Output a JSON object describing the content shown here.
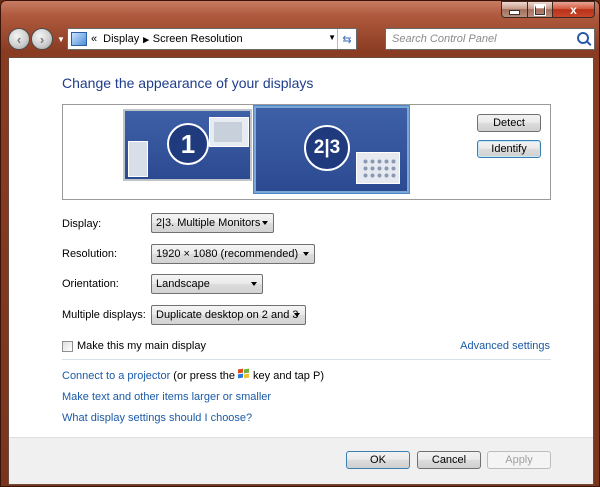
{
  "window": {
    "caption": {
      "minimize": "",
      "maximize": "",
      "close": "x"
    }
  },
  "nav": {
    "back": "‹",
    "forward": "›",
    "address": {
      "prefix": "«",
      "crumb1": "Display",
      "separator": "▸",
      "crumb2": "Screen Resolution"
    },
    "search": {
      "placeholder": "Search Control Panel"
    }
  },
  "content": {
    "title": "Change the appearance of your displays",
    "preview": {
      "monitor_1": "1",
      "monitor_23": "2|3",
      "detect_label": "Detect",
      "identify_label": "Identify"
    },
    "form": {
      "display": {
        "label": "Display:",
        "value": "2|3. Multiple Monitors"
      },
      "resolution": {
        "label": "Resolution:",
        "value": "1920 × 1080 (recommended)"
      },
      "orientation": {
        "label": "Orientation:",
        "value": "Landscape"
      },
      "multiple": {
        "label": "Multiple displays:",
        "value": "Duplicate desktop on 2 and 3"
      }
    },
    "main_display": {
      "label": "Make this my main display",
      "checked": false
    },
    "advanced_settings": "Advanced settings",
    "links": {
      "projector": "Connect to a projector",
      "projector_suffix_1": " (or press the",
      "projector_suffix_2": "key and tap P)",
      "text_size": "Make text and other items larger or smaller",
      "settings_help": "What display settings should I choose?"
    },
    "footer": {
      "ok": "OK",
      "cancel": "Cancel",
      "apply": "Apply"
    }
  }
}
